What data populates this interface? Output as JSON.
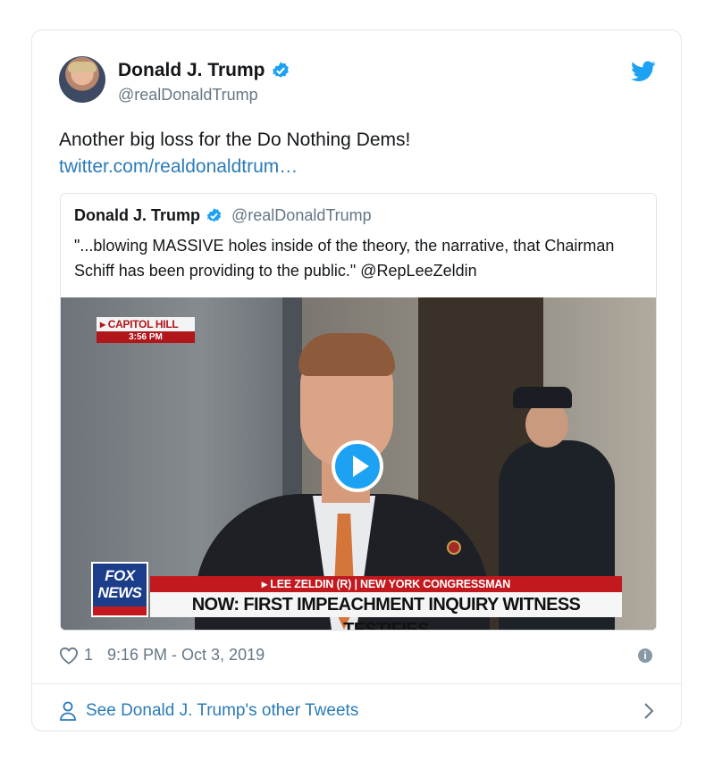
{
  "author": {
    "display_name": "Donald J. Trump",
    "handle": "@realDonaldTrump",
    "verified": true
  },
  "tweet": {
    "text": "Another big loss for the Do Nothing Dems!",
    "link": "twitter.com/realdonaldtrum…"
  },
  "quoted_tweet": {
    "display_name": "Donald J. Trump",
    "handle": "@realDonaldTrump",
    "text": "\"...blowing MASSIVE holes inside of the theory, the narrative, that Chairman Schiff has been providing to the public.\" @RepLeeZeldin"
  },
  "video": {
    "location_caption": "CAPITOL HILL",
    "time_caption": "3:56 PM",
    "network_line1": "FOX",
    "network_line2": "NEWS",
    "chyron_top": "▸ LEE ZELDIN (R) | NEW YORK CONGRESSMAN",
    "chyron_main": "NOW: FIRST IMPEACHMENT INQUIRY WITNESS TESTIFIES"
  },
  "meta": {
    "likes": "1",
    "timestamp": "9:16 PM - Oct 3, 2019"
  },
  "footer": {
    "label": "See Donald J. Trump's other Tweets"
  },
  "colors": {
    "link": "#2b7bb9",
    "verified": "#1da1f2",
    "muted": "#657786"
  }
}
